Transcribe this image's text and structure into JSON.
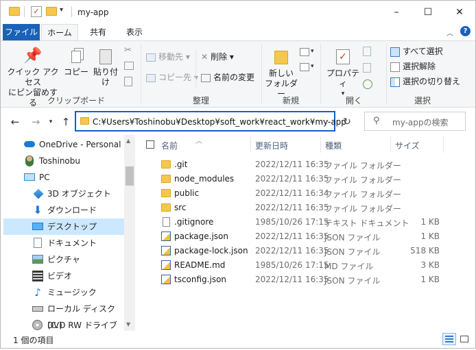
{
  "window": {
    "title": "my-app"
  },
  "ribbon_tabs": [
    "ファイル",
    "ホーム",
    "共有",
    "表示"
  ],
  "ribbon": {
    "clipboard": {
      "pin_label_line1": "クイック アクセス",
      "pin_label_line2": "にピン留めする",
      "copy": "コピー",
      "paste": "貼り付け",
      "group": "クリップボード"
    },
    "organize": {
      "move_to": "移動先",
      "copy_to": "コピー先",
      "delete": "削除",
      "rename": "名前の変更",
      "group": "整理"
    },
    "new": {
      "new_folder_line1": "新しい",
      "new_folder_line2": "フォルダー",
      "group": "新規"
    },
    "open": {
      "properties": "プロパティ",
      "group": "開く"
    },
    "select": {
      "select_all": "すべて選択",
      "select_none": "選択解除",
      "invert": "選択の切り替え",
      "group": "選択"
    }
  },
  "address": {
    "path": "C:¥Users¥Toshinobu¥Desktop¥soft_work¥react_work¥my-app",
    "search_placeholder": "my-appの検索"
  },
  "nav_pane": [
    {
      "label": "OneDrive - Personal",
      "icon": "cloud-icon",
      "selected": false
    },
    {
      "label": "Toshinobu",
      "icon": "user-icon",
      "selected": false
    },
    {
      "label": "PC",
      "icon": "pc-icon",
      "selected": false
    },
    {
      "label": "3D オブジェクト",
      "icon": "cube-icon",
      "selected": false
    },
    {
      "label": "ダウンロード",
      "icon": "download-icon",
      "selected": false
    },
    {
      "label": "デスクトップ",
      "icon": "desktop-icon",
      "selected": true
    },
    {
      "label": "ドキュメント",
      "icon": "document-icon",
      "selected": false
    },
    {
      "label": "ピクチャ",
      "icon": "pictures-icon",
      "selected": false
    },
    {
      "label": "ビデオ",
      "icon": "video-icon",
      "selected": false
    },
    {
      "label": "ミュージック",
      "icon": "music-icon",
      "selected": false
    },
    {
      "label": "ローカル ディスク (C:)",
      "icon": "disk-icon",
      "selected": false
    },
    {
      "label": "DVD RW ドライブ (D:)",
      "icon": "dvd-icon",
      "selected": false
    }
  ],
  "columns": {
    "name": "名前",
    "date": "更新日時",
    "type": "種類",
    "size": "サイズ"
  },
  "files": [
    {
      "name": ".git",
      "date": "2022/12/11 16:35",
      "type": "ファイル フォルダー",
      "size": "",
      "kind": "folder"
    },
    {
      "name": "node_modules",
      "date": "2022/12/11 16:35",
      "type": "ファイル フォルダー",
      "size": "",
      "kind": "folder"
    },
    {
      "name": "public",
      "date": "2022/12/11 16:34",
      "type": "ファイル フォルダー",
      "size": "",
      "kind": "folder"
    },
    {
      "name": "src",
      "date": "2022/12/11 16:35",
      "type": "ファイル フォルダー",
      "size": "",
      "kind": "folder"
    },
    {
      "name": ".gitignore",
      "date": "1985/10/26 17:15",
      "type": "テキスト ドキュメント",
      "size": "1 KB",
      "kind": "text"
    },
    {
      "name": "package.json",
      "date": "2022/12/11 16:35",
      "type": "JSON ファイル",
      "size": "1 KB",
      "kind": "json"
    },
    {
      "name": "package-lock.json",
      "date": "2022/12/11 16:35",
      "type": "JSON ファイル",
      "size": "518 KB",
      "kind": "json"
    },
    {
      "name": "README.md",
      "date": "1985/10/26 17:15",
      "type": "MD ファイル",
      "size": "3 KB",
      "kind": "json"
    },
    {
      "name": "tsconfig.json",
      "date": "2022/12/11 16:35",
      "type": "JSON ファイル",
      "size": "1 KB",
      "kind": "json"
    }
  ],
  "status": {
    "text": "1 個の項目"
  }
}
